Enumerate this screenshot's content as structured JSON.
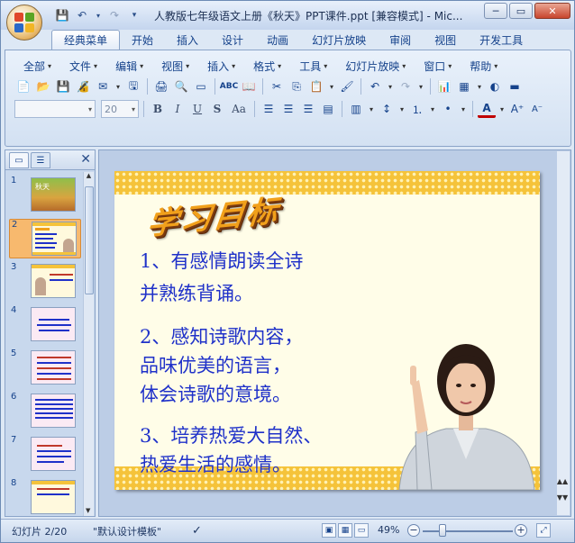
{
  "window": {
    "title": "人教版七年级语文上册《秋天》PPT课件.ppt [兼容模式] - Mic...",
    "minimize": "─",
    "restore": "▭",
    "close": "✕"
  },
  "quick_access": [
    "save-icon",
    "undo-icon",
    "redo-icon",
    "customize-icon"
  ],
  "tabs": [
    "经典菜单",
    "开始",
    "插入",
    "设计",
    "动画",
    "幻灯片放映",
    "审阅",
    "视图",
    "开发工具"
  ],
  "active_tab": "经典菜单",
  "menus": [
    "全部",
    "文件",
    "编辑",
    "视图",
    "插入",
    "格式",
    "工具",
    "幻灯片放映",
    "窗口",
    "帮助"
  ],
  "font": {
    "name": "",
    "size": "20"
  },
  "format_buttons": [
    "B",
    "I",
    "U",
    "S",
    "Aa"
  ],
  "left_panel": {
    "tabs": [
      "▭",
      "☰"
    ],
    "close": "✕",
    "slides": [
      "1",
      "2",
      "3",
      "4",
      "5",
      "6",
      "7",
      "8"
    ],
    "selected": "2"
  },
  "slide": {
    "title": "学习目标",
    "lines": [
      "1、有感情朗读全诗",
      "并熟练背诵。",
      "2、感知诗歌内容，",
      "品味优美的语言，",
      "体会诗歌的意境。",
      "3、培养热爱大自然、",
      "热爱生活的感情。"
    ],
    "colors": {
      "title": "#f1a01b",
      "text": "#1f31c9",
      "band": "#f5c33a"
    }
  },
  "status": {
    "slide_counter": "幻灯片 2/20",
    "theme": "\"默认设计模板\"",
    "zoom": "49%"
  }
}
